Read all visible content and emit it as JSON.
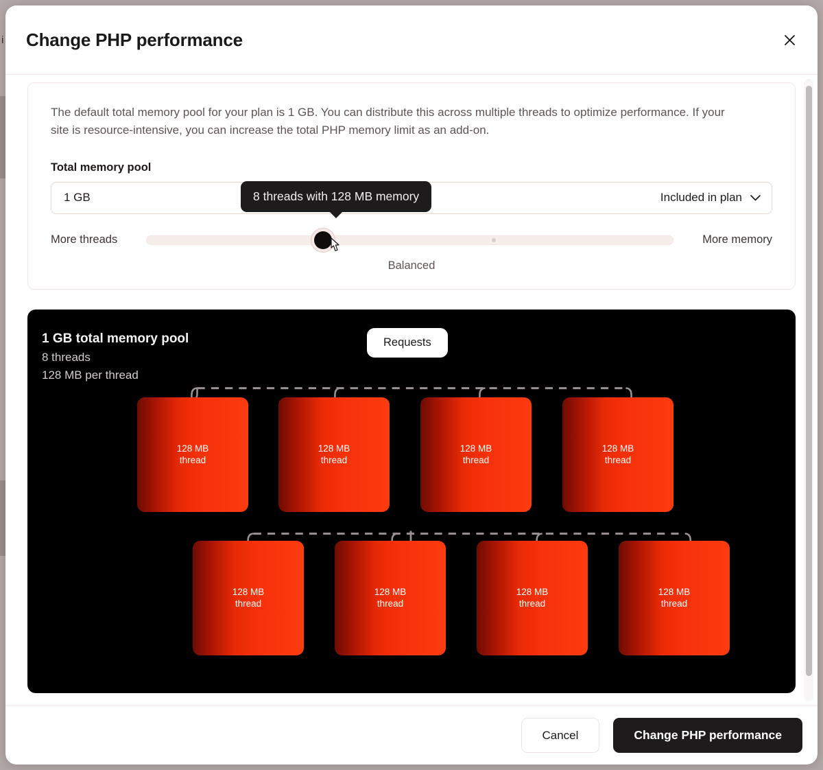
{
  "modal": {
    "title": "Change PHP performance",
    "close_icon": "close-icon"
  },
  "settings": {
    "description": "The default total memory pool for your plan is 1 GB. You can distribute this across multiple threads to optimize performance. If your site is resource-intensive, you can increase the total PHP memory limit as an add-on.",
    "memory_pool_label": "Total memory pool",
    "memory_pool_value": "1 GB",
    "plan_option_selected": "Included in plan",
    "plan_options": [
      "Included in plan"
    ],
    "chevron_icon": "chevron-down-icon"
  },
  "slider": {
    "left_label": "More threads",
    "right_label": "More memory",
    "mode_label": "Balanced",
    "tooltip": "8 threads with 128 MB memory",
    "value_percent": 33.5,
    "tick_percent": 66,
    "cursor_icon": "cursor-pointer-icon"
  },
  "diagram": {
    "total_pool": "1 GB total memory pool",
    "thread_count_label": "8 threads",
    "per_thread_label": "128 MB per thread",
    "requests_badge": "Requests",
    "threads": [
      {
        "size": "128 MB",
        "kind": "thread"
      },
      {
        "size": "128 MB",
        "kind": "thread"
      },
      {
        "size": "128 MB",
        "kind": "thread"
      },
      {
        "size": "128 MB",
        "kind": "thread"
      },
      {
        "size": "128 MB",
        "kind": "thread"
      },
      {
        "size": "128 MB",
        "kind": "thread"
      },
      {
        "size": "128 MB",
        "kind": "thread"
      },
      {
        "size": "128 MB",
        "kind": "thread"
      }
    ]
  },
  "footer": {
    "cancel_label": "Cancel",
    "submit_label": "Change PHP performance"
  },
  "colors": {
    "accent_red": "#f8310a",
    "dark": "#1d1b1b",
    "border": "#f0e6e3",
    "backdrop": "#b3a8a8"
  }
}
